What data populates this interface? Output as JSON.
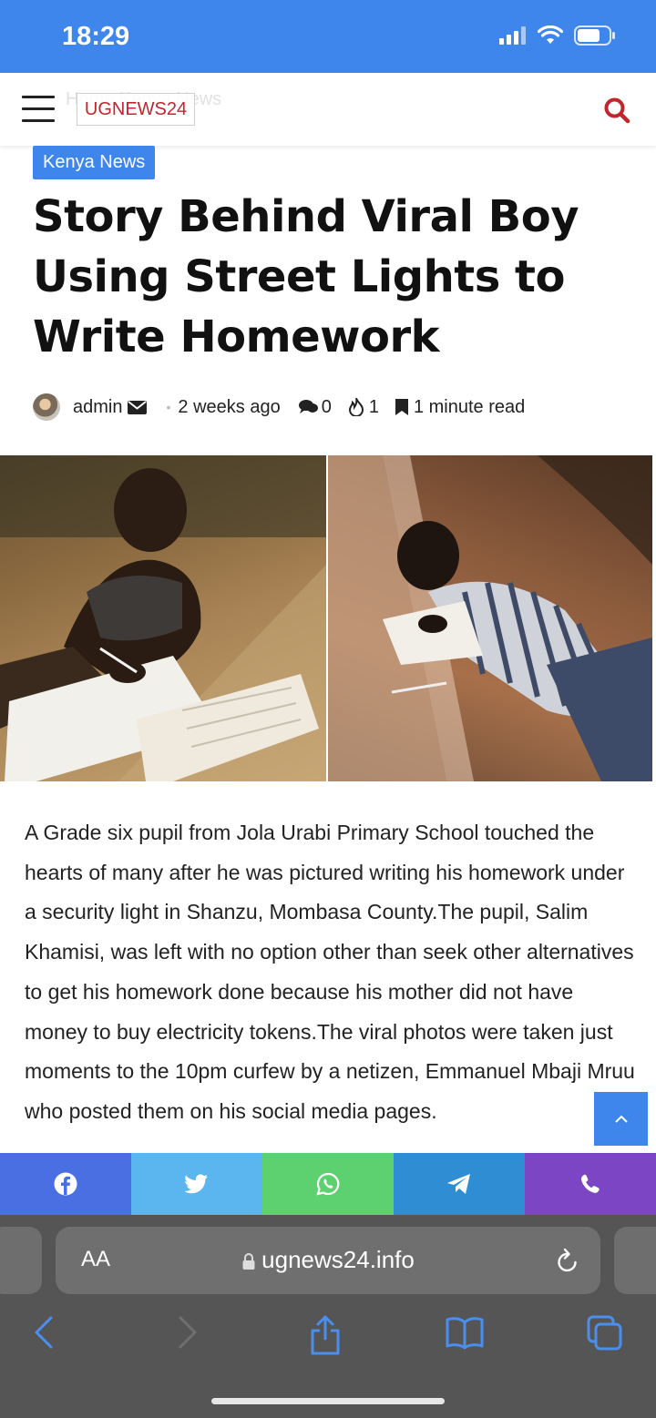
{
  "status_bar": {
    "time": "18:29"
  },
  "header": {
    "logo_text": "UGNEWS24",
    "ghost_text": "Home   Kenya News",
    "icons": [
      "menu-icon",
      "search-icon"
    ]
  },
  "article": {
    "category": "Kenya News",
    "title": "Story Behind Viral Boy Using Street Lights to Write Homework",
    "author": "admin",
    "date": "2 weeks ago",
    "comments": "0",
    "views": "1",
    "read_time": "1 minute read",
    "body": "A Grade six pupil from Jola Urabi Primary School touched the hearts of many after he was pictured writing his homework under a security light in Shanzu, Mombasa County.The pupil, Salim Khamisi, was left with no option other than seek other alternatives to get his homework done because his mother did not have money to buy electricity tokens.The viral photos were taken just moments to the 10pm curfew by a netizen, Emmanuel Mbaji Mruu who posted them on his social media pages."
  },
  "share_bar": [
    {
      "name": "facebook",
      "color": "#4a6fe3"
    },
    {
      "name": "twitter",
      "color": "#5bb5ee"
    },
    {
      "name": "whatsapp",
      "color": "#5dd16f"
    },
    {
      "name": "telegram",
      "color": "#2f8dd4"
    },
    {
      "name": "viber",
      "color": "#7b45c4"
    }
  ],
  "browser": {
    "aa_label": "AA",
    "url": "ugnews24.info"
  },
  "colors": {
    "accent": "#3e86ec",
    "logo_red": "#c0262d",
    "browser_gray": "#555555",
    "toolbar_blue": "#4a8ff0"
  }
}
